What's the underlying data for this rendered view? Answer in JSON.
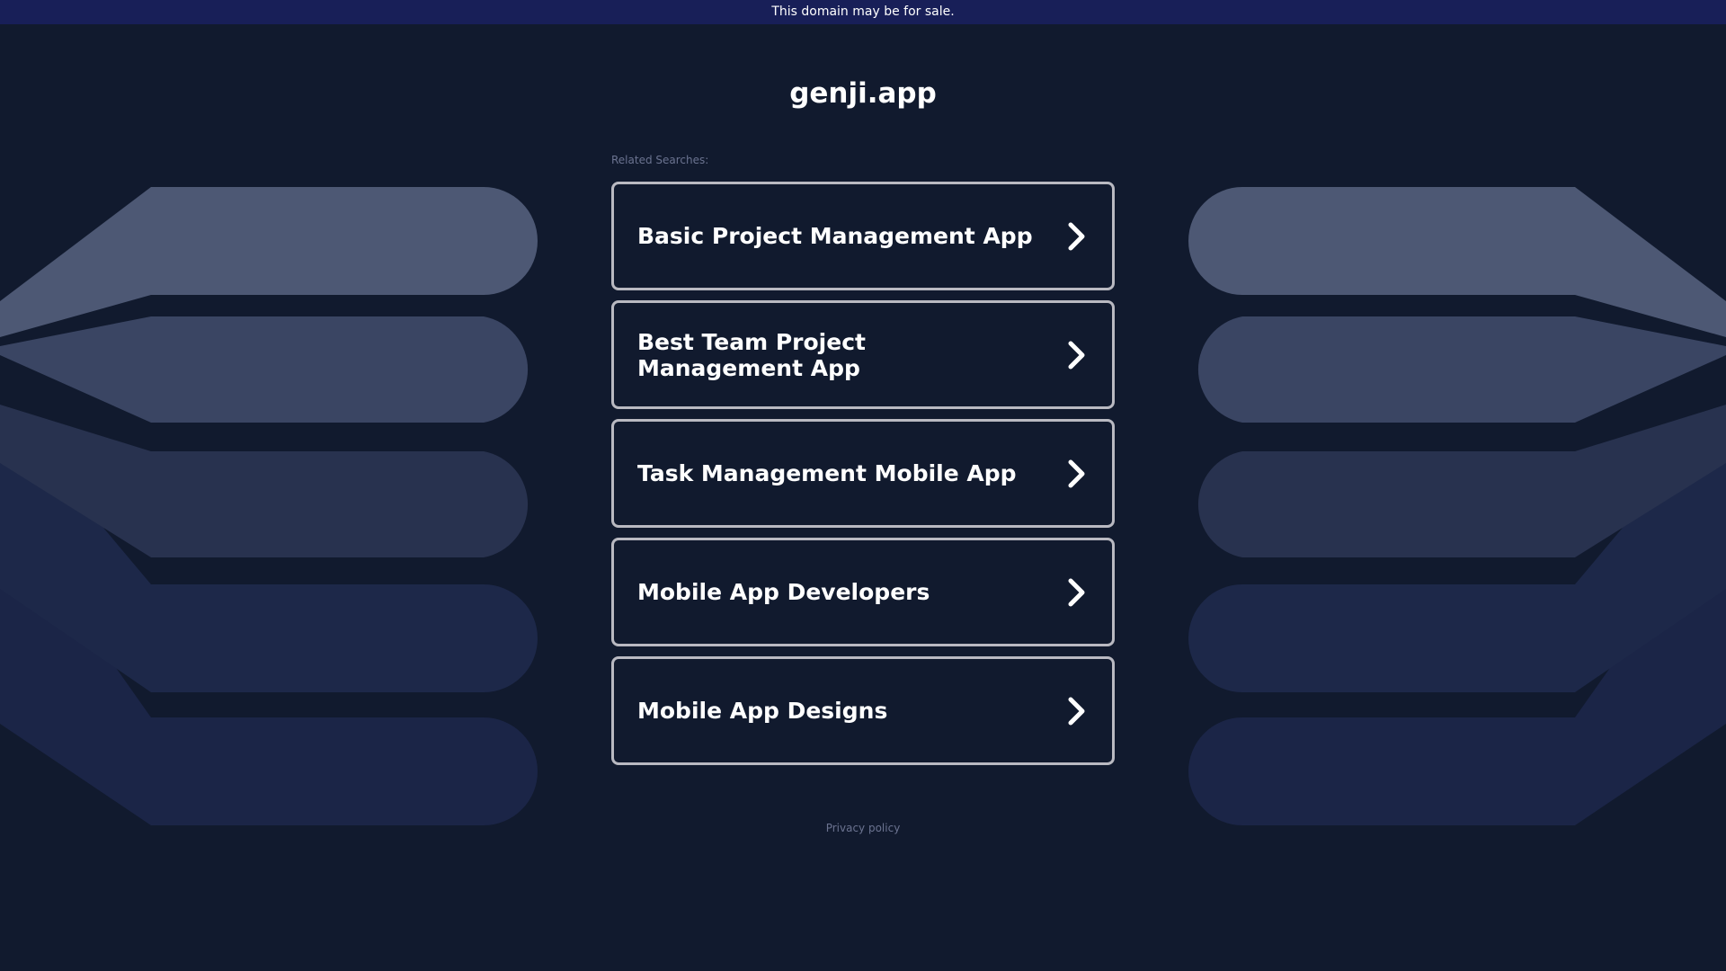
{
  "banner": {
    "text": "This domain may be for sale."
  },
  "domain": {
    "title": "genji.app"
  },
  "related": {
    "label": "Related Searches:",
    "items": [
      {
        "label": "Basic Project Management App"
      },
      {
        "label": "Best Team Project Management App"
      },
      {
        "label": "Task Management Mobile App"
      },
      {
        "label": "Mobile App Developers"
      },
      {
        "label": "Mobile App Designs"
      }
    ]
  },
  "footer": {
    "privacy_label": "Privacy policy"
  },
  "icons": {
    "chevron": "chevron-right-icon"
  },
  "colors": {
    "background": "#111a2e",
    "banner": "#181f58",
    "box_border": "#b9b9c1",
    "text": "#ffffff",
    "muted_text": "#6b7390"
  }
}
